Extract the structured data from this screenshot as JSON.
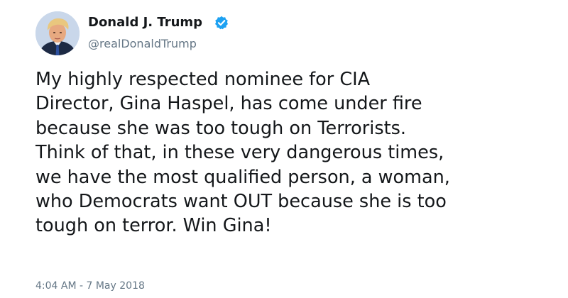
{
  "user": {
    "display_name": "Donald J. Trump",
    "handle": "@realDonaldTrump",
    "verified_icon": "verified-badge-icon",
    "verified_color": "#1da1f2"
  },
  "tweet": {
    "lines": [
      "My highly respected nominee for CIA",
      "Director, Gina Haspel, has come under fire",
      "because she was too tough on Terrorists.",
      "Think of that, in these very dangerous times,",
      "we have the most qualified person, a woman,",
      "who Democrats want OUT because she is too",
      "tough on terror. Win Gina!"
    ],
    "timestamp": "4:04 AM - 7 May 2018"
  },
  "colors": {
    "text": "#14171a",
    "secondary_text": "#657786"
  }
}
